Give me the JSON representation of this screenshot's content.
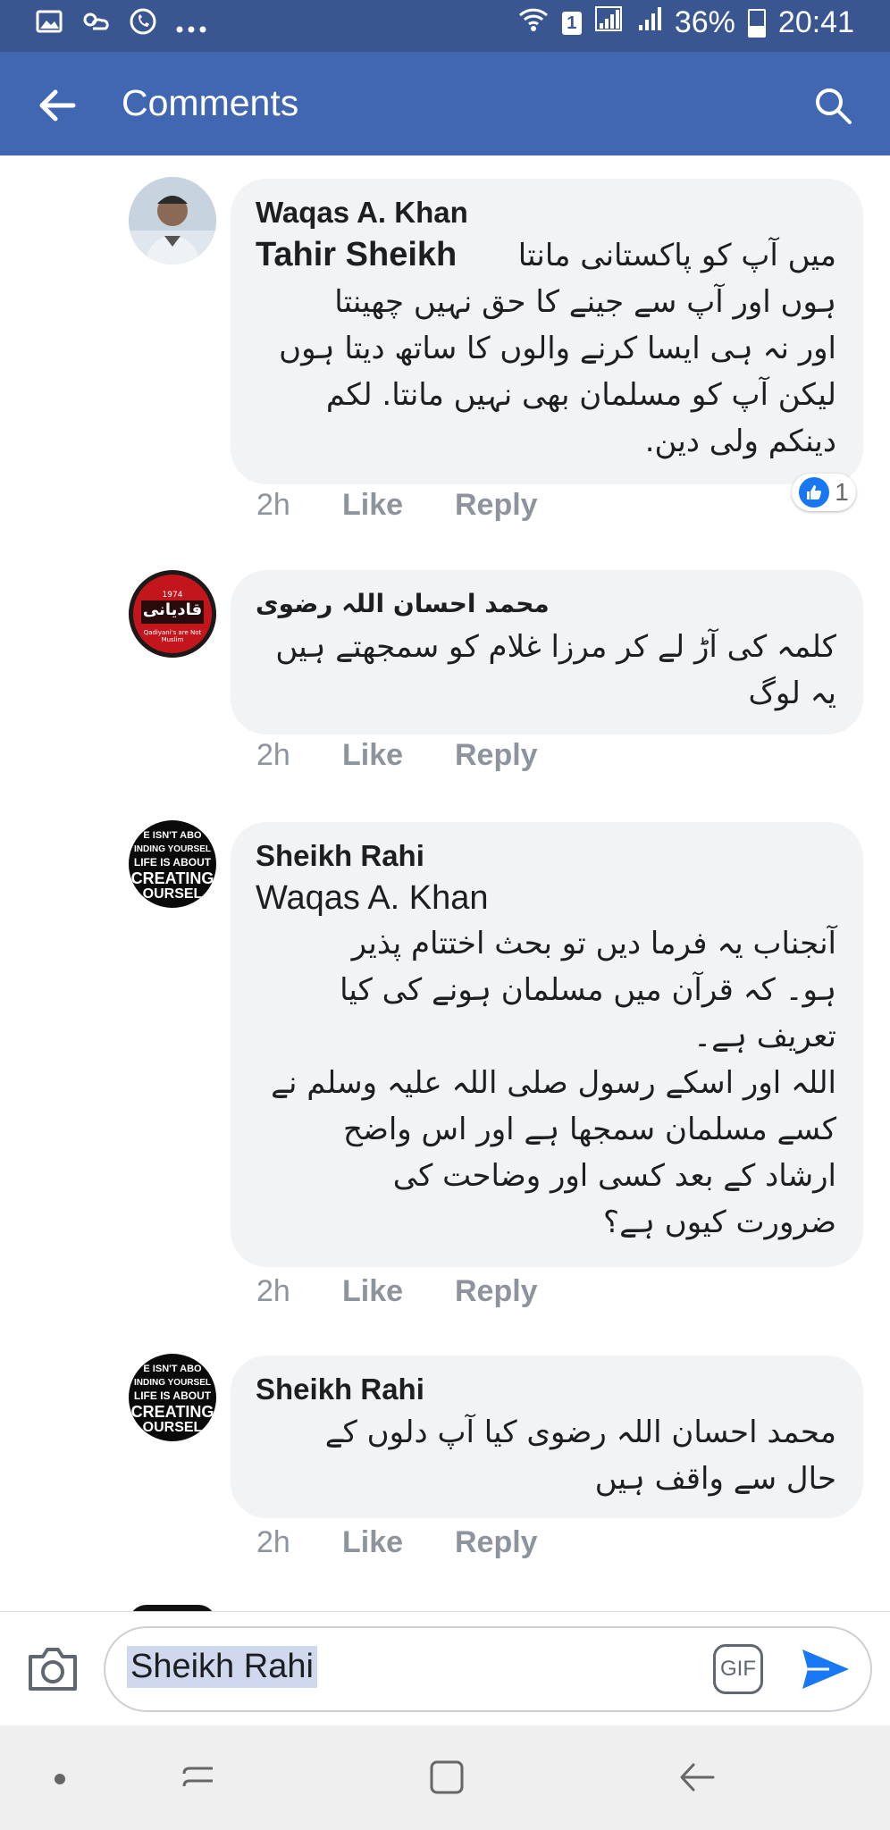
{
  "status_bar": {
    "battery": "36%",
    "time": "20:41",
    "sim": "1"
  },
  "app_bar": {
    "title": "Comments"
  },
  "comments": [
    {
      "author": "Waqas A. Khan",
      "mention": "Tahir Sheikh",
      "text": "میں آپ کو پاکستانی مانتا\nہوں اور آپ سے جینے کا حق نہیں چھینتا\nاور نہ ہی ایسا کرنے والوں کا ساتھ دیتا ہوں\nلیکن آپ کو مسلمان بھی نہیں مانتا. لکم\nدینکم ولی دین.",
      "time": "2h",
      "like": "Like",
      "reply": "Reply",
      "like_count": "1"
    },
    {
      "author": "محمد احسان اللہ رضوی",
      "text": "کلمہ کی آڑ لے کر مرزا غلام کو سمجھتے ہیں\nیہ لوگ",
      "time": "2h",
      "like": "Like",
      "reply": "Reply",
      "avatar_text": "قادیانی",
      "avatar_sub": "Qadiyani's are Not Muslim"
    },
    {
      "author": "Sheikh Rahi",
      "mention": "Waqas A. Khan",
      "text": "آنجناب یہ فرما دیں تو بحث اختتام پذیر\nہو۔ کہ قرآن میں مسلمان ہونے کی کیا\nتعریف ہے۔\nاللہ اور اسکے رسول صلی اللہ علیہ وسلم نے\nکسے مسلمان سمجھا ہے اور اس واضح\nارشاد کے بعد کسی اور وضاحت کی\nضرورت کیوں ہے؟",
      "time": "2h",
      "like": "Like",
      "reply": "Reply",
      "avatar_lines": [
        "E ISN'T ABO",
        "INDING YOURSEL",
        "LIFE IS ABOUT",
        "CREATING",
        "OURSEL"
      ]
    },
    {
      "author": "Sheikh Rahi",
      "text": "محمد احسان اللہ رضوی کیا آپ دلوں کے\nحال سے واقف ہیں",
      "time": "2h",
      "like": "Like",
      "reply": "Reply",
      "avatar_lines": [
        "E ISN'T ABO",
        "INDING YOURSEL",
        "LIFE IS ABOUT",
        "CREATING",
        "OURSEL"
      ]
    }
  ],
  "composer": {
    "value": "Sheikh Rahi",
    "gif_label": "GIF"
  },
  "colors": {
    "header": "#4267b2",
    "status": "#3a5690",
    "bubble": "#f2f3f5",
    "like_blue": "#1877f2"
  }
}
